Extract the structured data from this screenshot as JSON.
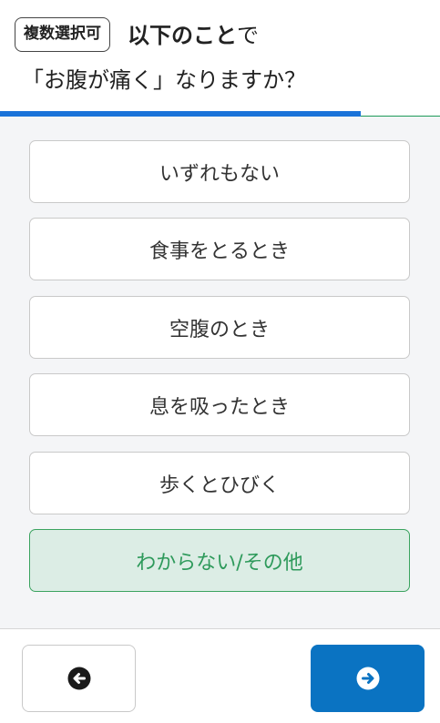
{
  "header": {
    "badge": "複数選択可",
    "title_bold": "以下のこと",
    "title_suffix": "で",
    "question": "「お腹が痛く」なりますか？"
  },
  "progress": {
    "fraction": 0.82
  },
  "options": [
    {
      "label": "いずれもない",
      "selected": false
    },
    {
      "label": "食事をとるとき",
      "selected": false
    },
    {
      "label": "空腹のとき",
      "selected": false
    },
    {
      "label": "息を吸ったとき",
      "selected": false
    },
    {
      "label": "歩くとひびく",
      "selected": false
    },
    {
      "label": "わからない/その他",
      "selected": true
    }
  ],
  "footer": {
    "back_icon": "arrow-left-circle-icon",
    "next_icon": "arrow-right-circle-icon"
  },
  "colors": {
    "progress": "#1a73d9",
    "selected_bg": "#dcede5",
    "selected_text": "#2e9a5b",
    "next_button": "#0a73c2"
  }
}
